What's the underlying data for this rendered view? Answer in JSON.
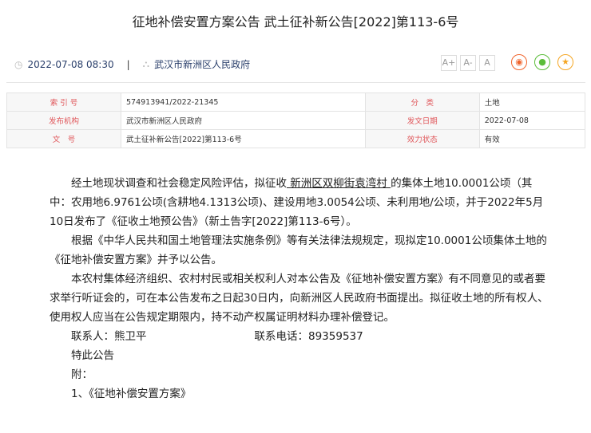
{
  "title": "征地补偿安置方案公告 武土征补新公告[2022]第113-6号",
  "meta": {
    "datetime": "2022-07-08 08:30",
    "separator": "|",
    "publisher": "武汉市新洲区人民政府"
  },
  "font_tools": [
    "A+",
    "A-",
    "A"
  ],
  "share": [
    {
      "name": "weibo",
      "color": "#f0642c"
    },
    {
      "name": "wechat",
      "color": "#5bbd3a"
    },
    {
      "name": "favorite",
      "color": "#f5a623"
    }
  ],
  "info_table": [
    [
      "索 引 号",
      "574913941/2022-21345",
      "分　类",
      "土地"
    ],
    [
      "发布机构",
      "武汉市新洲区人民政府",
      "发文日期",
      "2022-07-08"
    ],
    [
      "文　号",
      "武土征补新公告[2022]第113-6号",
      "效力状态",
      "有效"
    ]
  ],
  "content": {
    "p1_a": "经土地现状调查和社会稳定风险评估，拟征收",
    "p1_place": " 新洲区双柳街袁湾村 ",
    "p1_b": "的集体土地10.0001公顷（其中：农用地6.9761公顷(含耕地4.1313公顷)、建设用地3.0054公顷、未利用地/公顷，并于2022年5月10日发布了《征收土地预公告》（新土告字[2022]第113-6号）。",
    "p2": "根据《中华人民共和国土地管理法实施条例》等有关法律法规规定，现拟定10.0001公顷集体土地的《征地补偿安置方案》并予以公告。",
    "p3": "本农村集体经济组织、农村村民或相关权利人对本公告及《征地补偿安置方案》有不同意见的或者要求举行听证会的，可在本公告发布之日起30日内，向新洲区人民政府书面提出。拟征收土地的所有权人、使用权人应当在公告规定期限内，持不动产权属证明材料办理补偿登记。",
    "contact": "联系人：熊卫平",
    "phone": "联系电话：89359537",
    "notice": "特此公告",
    "attach": "附：",
    "attach1": "1、《征地补偿安置方案》"
  }
}
